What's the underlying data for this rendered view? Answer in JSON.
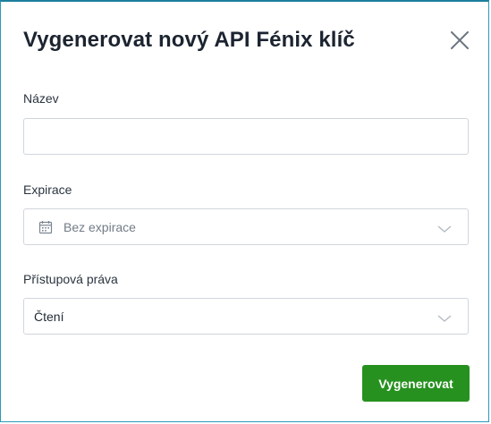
{
  "dialog": {
    "title": "Vygenerovat nový API Fénix klíč",
    "close_icon": "close-icon"
  },
  "name_field": {
    "label": "Název",
    "value": "",
    "placeholder": ""
  },
  "expiration_field": {
    "label": "Expirace",
    "selected": "Bez expirace",
    "icon": "calendar-icon"
  },
  "permissions_field": {
    "label": "Přístupová práva",
    "selected": "Čtení"
  },
  "actions": {
    "generate_label": "Vygenerovat"
  },
  "colors": {
    "primary": "#26911f",
    "border": "#cfd6dd",
    "frame": "#2a9ab8"
  }
}
